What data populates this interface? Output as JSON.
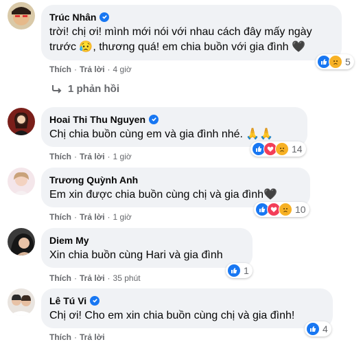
{
  "comments": [
    {
      "name": "Trúc Nhân",
      "text_line1": "trời! chị ơi! mình mới nói với nhau cách đây mấy ngày",
      "text_line2": "trước 😥, thương quá! em chia buồn với gia đình 🖤",
      "like_label": "Thích",
      "reply_label": "Trả lời",
      "time": "4 giờ",
      "reaction_count": "5",
      "reactions": [
        "like-icon",
        "sad-icon"
      ]
    },
    {
      "name": "Hoai Thi Thu Nguyen",
      "text": "Chị chia buồn cùng em và gia đình nhé. 🙏🙏",
      "like_label": "Thích",
      "reply_label": "Trả lời",
      "time": "1 giờ",
      "reaction_count": "14",
      "reactions": [
        "like-icon",
        "love-icon",
        "sad-icon"
      ]
    },
    {
      "name": "Trương Quỳnh Anh",
      "text": "Em xin được chia buồn cùng chị và gia đình🖤",
      "like_label": "Thích",
      "reply_label": "Trả lời",
      "time": "1 giờ",
      "reaction_count": "10",
      "reactions": [
        "like-icon",
        "love-icon",
        "sad-icon"
      ]
    },
    {
      "name": "Diem My",
      "text": "Xin chia buồn cùng Hari và gia đình",
      "like_label": "Thích",
      "reply_label": "Trả lời",
      "time": "35 phút",
      "reaction_count": "1",
      "reactions": [
        "like-icon"
      ]
    },
    {
      "name": "Lê Tú Vi",
      "text": "Chị ơi! Cho em xin chia buồn cùng chị và gia đình!",
      "like_label": "Thích",
      "reply_label": "Trả lời",
      "time": "",
      "reaction_count": "4",
      "reactions": [
        "like-icon"
      ]
    }
  ],
  "reply_toggle": "1 phản hồi",
  "colors": {
    "like": "#1877f2",
    "love": "#f33e58",
    "sad": "#f7b125",
    "bubble": "#f0f2f5",
    "meta": "#65676b"
  }
}
